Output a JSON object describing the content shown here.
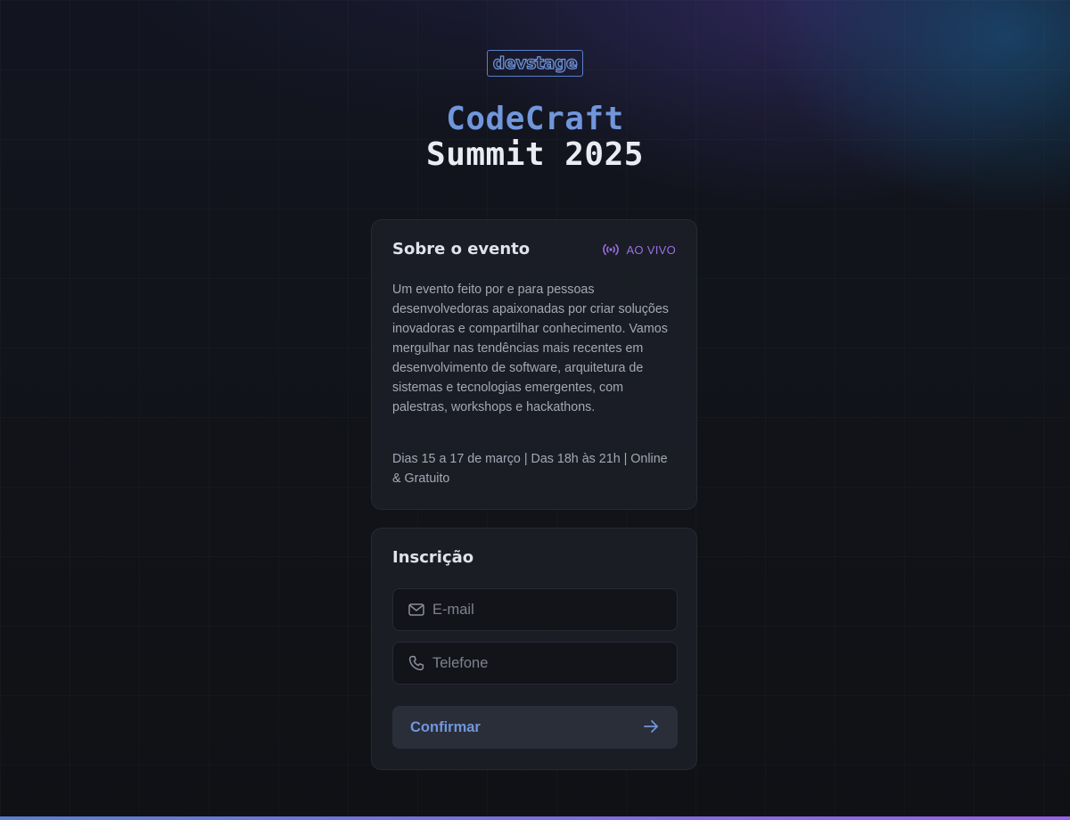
{
  "brand": {
    "logo_text": "devstage"
  },
  "hero": {
    "title_line1": "CodeCraft",
    "title_line2": "Summit 2025"
  },
  "about": {
    "title": "Sobre o evento",
    "live_label": "AO VIVO",
    "live_icon": "broadcast-icon",
    "description": "Um evento feito por e para pessoas desenvolvedoras apaixonadas por criar soluções inovadoras e compartilhar conhecimento. Vamos mergulhar nas tendências mais recentes em desenvolvimento de software, arquitetura de sistemas e tecnologias emergentes, com palestras, workshops e hackathons.",
    "info": "Dias 15 a 17 de março | Das 18h às 21h | Online & Gratuito"
  },
  "registration": {
    "title": "Inscrição",
    "email": {
      "placeholder": "E-mail",
      "value": "",
      "icon": "mail-icon"
    },
    "phone": {
      "placeholder": "Telefone",
      "value": "",
      "icon": "phone-icon"
    },
    "confirm_label": "Confirmar",
    "confirm_icon": "arrow-right-icon"
  },
  "colors": {
    "accent_blue": "#7096dc",
    "accent_purple": "#9b6ee6",
    "background": "#111318",
    "card": "#1b1e26"
  }
}
